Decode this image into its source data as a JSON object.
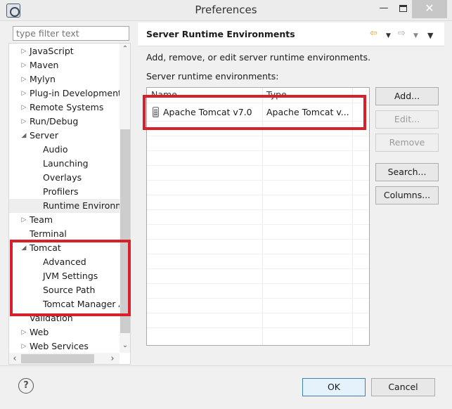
{
  "window": {
    "title": "Preferences",
    "min_icon": "minimize-icon",
    "max_icon": "maximize-icon",
    "close_glyph": "✕"
  },
  "filter": {
    "placeholder": "type filter text"
  },
  "tree": [
    {
      "label": "JavaScript",
      "level": 0,
      "twisty": "▷"
    },
    {
      "label": "Maven",
      "level": 0,
      "twisty": "▷"
    },
    {
      "label": "Mylyn",
      "level": 0,
      "twisty": "▷"
    },
    {
      "label": "Plug-in Development",
      "level": 0,
      "twisty": "▷"
    },
    {
      "label": "Remote Systems",
      "level": 0,
      "twisty": "▷"
    },
    {
      "label": "Run/Debug",
      "level": 0,
      "twisty": "▷"
    },
    {
      "label": "Server",
      "level": 0,
      "twisty": "◢"
    },
    {
      "label": "Audio",
      "level": 1,
      "twisty": ""
    },
    {
      "label": "Launching",
      "level": 1,
      "twisty": ""
    },
    {
      "label": "Overlays",
      "level": 1,
      "twisty": ""
    },
    {
      "label": "Profilers",
      "level": 1,
      "twisty": ""
    },
    {
      "label": "Runtime Environm",
      "level": 1,
      "twisty": "",
      "selected": true
    },
    {
      "label": "Team",
      "level": 0,
      "twisty": "▷"
    },
    {
      "label": "Terminal",
      "level": 0,
      "twisty": ""
    },
    {
      "label": "Tomcat",
      "level": 0,
      "twisty": "◢"
    },
    {
      "label": "Advanced",
      "level": 1,
      "twisty": ""
    },
    {
      "label": "JVM Settings",
      "level": 1,
      "twisty": ""
    },
    {
      "label": "Source Path",
      "level": 1,
      "twisty": ""
    },
    {
      "label": "Tomcat Manager A",
      "level": 1,
      "twisty": ""
    },
    {
      "label": "Validation",
      "level": 0,
      "twisty": ""
    },
    {
      "label": "Web",
      "level": 0,
      "twisty": "▷"
    },
    {
      "label": "Web Services",
      "level": 0,
      "twisty": "▷"
    }
  ],
  "scroll": {
    "up": "⌃",
    "down": "⌄",
    "left": "‹",
    "right": "›"
  },
  "page": {
    "title": "Server Runtime Environments",
    "description": "Add, remove, or edit server runtime environments.",
    "list_label": "Server runtime environments:",
    "columns": [
      "Name",
      "Type"
    ],
    "rows": [
      {
        "name": "Apache Tomcat v7.0",
        "type": "Apache Tomcat v..."
      }
    ],
    "buttons": {
      "add": "Add...",
      "edit": "Edit...",
      "remove": "Remove",
      "search": "Search...",
      "columns": "Columns..."
    },
    "nav": {
      "back_icon": "back-arrow-icon",
      "forward_icon": "forward-arrow-icon",
      "menu_icon": "view-menu-icon"
    }
  },
  "footer": {
    "help": "?",
    "ok": "OK",
    "cancel": "Cancel"
  },
  "colors": {
    "highlight_box": "#d8202a",
    "ok_border": "#3c7fb1"
  }
}
